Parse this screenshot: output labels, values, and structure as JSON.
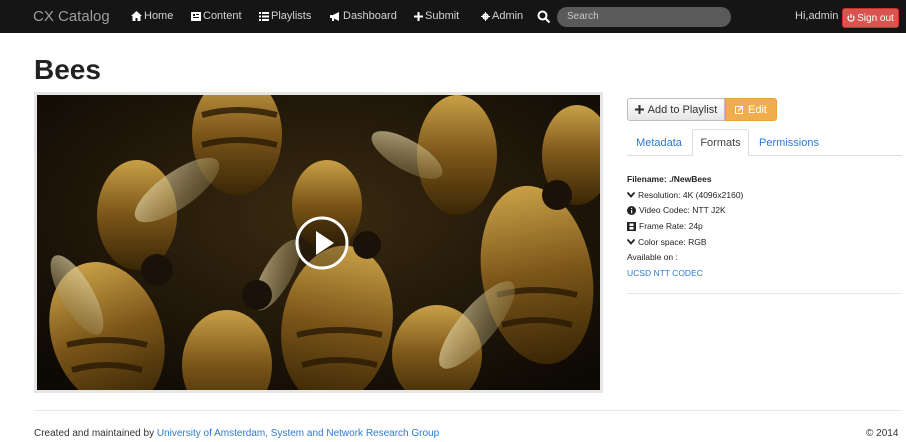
{
  "navbar": {
    "brand": "CX Catalog",
    "items": [
      {
        "label": "Home",
        "icon": "home-icon"
      },
      {
        "label": "Content",
        "icon": "content-icon"
      },
      {
        "label": "Playlists",
        "icon": "list-icon"
      },
      {
        "label": "Dashboard",
        "icon": "bullhorn-icon"
      },
      {
        "label": "Submit",
        "icon": "plus-icon"
      },
      {
        "label": "Admin",
        "icon": "gear-icon"
      }
    ],
    "search_placeholder": "Search",
    "greeting": "Hi,admin",
    "signout_label": "Sign out",
    "signout_color": "#d9534f",
    "bar_color": "#151515"
  },
  "page": {
    "title": "Bees"
  },
  "video": {
    "play_icon": "play-icon"
  },
  "actions": {
    "add_playlist": "Add to Playlist",
    "edit": "Edit",
    "edit_color": "#f0ad4e"
  },
  "tabs": [
    {
      "label": "Metadata",
      "active": false
    },
    {
      "label": "Formats",
      "active": true
    },
    {
      "label": "Permissions",
      "active": false
    }
  ],
  "formats": {
    "filename_label": "Filename: ./NewBees",
    "resolution": "Resolution: 4K (4096x2160)",
    "video_codec": "Video Codec: NTT J2K",
    "frame_rate": "Frame Rate: 24p",
    "color_space": "Color space: RGB",
    "available_on": "Available on :",
    "available_link": "UCSD NTT CODEC"
  },
  "footer": {
    "prefix": "Created and maintained by ",
    "link": "University of Amsterdam, System and Network Research Group",
    "copyright": "© 2014"
  },
  "link_color": "#2a7bd5"
}
